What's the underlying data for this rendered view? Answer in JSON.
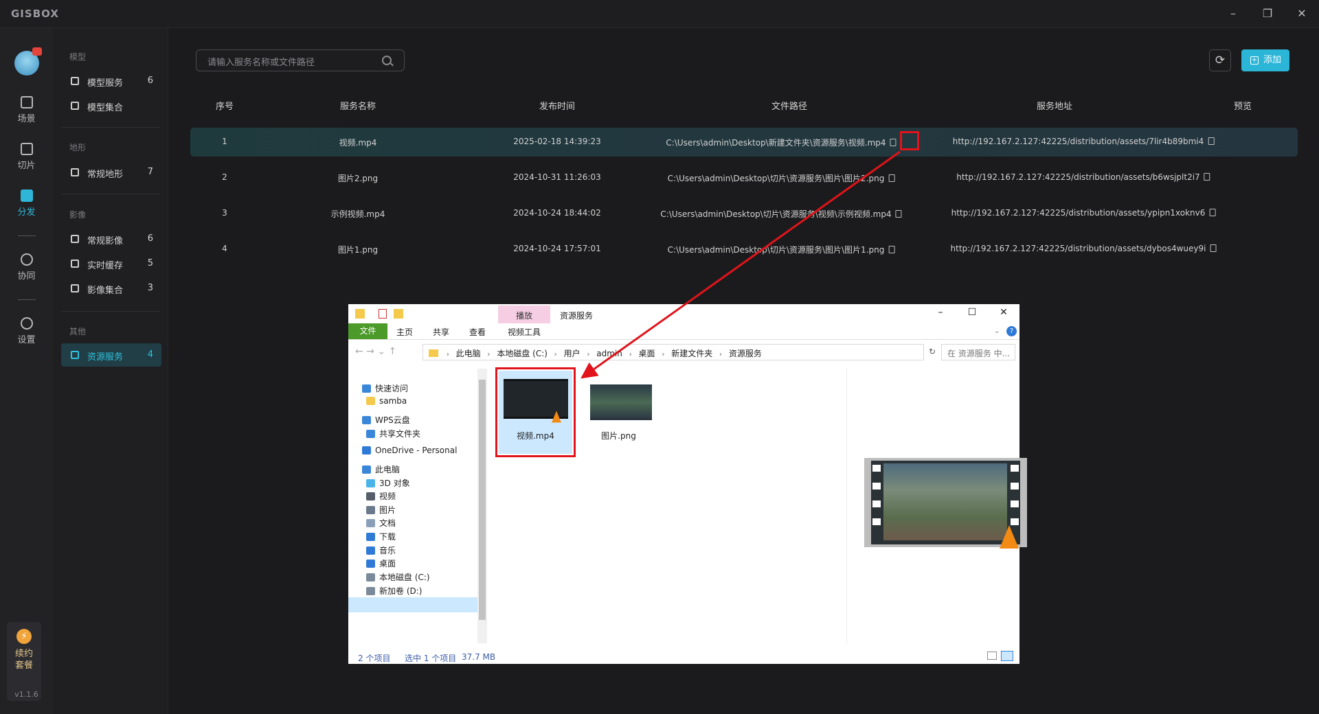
{
  "app": {
    "logo": "GISBOX",
    "version": "v1.1.6"
  },
  "rail": {
    "items": [
      {
        "label": "场景"
      },
      {
        "label": "切片"
      },
      {
        "label": "分发",
        "active": true
      },
      {
        "label": "协同"
      },
      {
        "label": "设置"
      }
    ],
    "promo": {
      "line1": "续约",
      "line2": "套餐"
    }
  },
  "nav": {
    "sections": [
      {
        "title": "模型",
        "items": [
          {
            "label": "模型服务",
            "count": "6"
          },
          {
            "label": "模型集合",
            "count": ""
          }
        ]
      },
      {
        "title": "地形",
        "items": [
          {
            "label": "常规地形",
            "count": "7"
          }
        ]
      },
      {
        "title": "影像",
        "items": [
          {
            "label": "常规影像",
            "count": "6"
          },
          {
            "label": "实时缓存",
            "count": "5"
          },
          {
            "label": "影像集合",
            "count": "3"
          }
        ]
      },
      {
        "title": "其他",
        "items": [
          {
            "label": "资源服务",
            "count": "4",
            "active": true
          }
        ]
      }
    ]
  },
  "toolbar": {
    "search_placeholder": "请输入服务名称或文件路径",
    "add_label": "添加"
  },
  "table": {
    "headers": [
      "序号",
      "服务名称",
      "发布时间",
      "文件路径",
      "服务地址",
      "预览"
    ],
    "rows": [
      {
        "idx": "1",
        "name": "视频.mp4",
        "time": "2025-02-18 14:39:23",
        "path": "C:\\Users\\admin\\Desktop\\新建文件夹\\资源服务\\视频.mp4",
        "url": "http://192.167.2.127:42225/distribution/assets/7lir4b89bmi4",
        "selected": true
      },
      {
        "idx": "2",
        "name": "图片2.png",
        "time": "2024-10-31 11:26:03",
        "path": "C:\\Users\\admin\\Desktop\\切片\\资源服务\\图片\\图片2.png",
        "url": "http://192.167.2.127:42225/distribution/assets/b6wsjplt2i7"
      },
      {
        "idx": "3",
        "name": "示例视频.mp4",
        "time": "2024-10-24 18:44:02",
        "path": "C:\\Users\\admin\\Desktop\\切片\\资源服务\\视频\\示例视频.mp4",
        "url": "http://192.167.2.127:42225/distribution/assets/ypipn1xoknv6"
      },
      {
        "idx": "4",
        "name": "图片1.png",
        "time": "2024-10-24 17:57:01",
        "path": "C:\\Users\\admin\\Desktop\\切片\\资源服务\\图片\\图片1.png",
        "url": "http://192.167.2.127:42225/distribution/assets/dybos4wuey9i"
      }
    ]
  },
  "explorer": {
    "context_tab": "播放",
    "title": "资源服务",
    "ribbon": {
      "file": "文件",
      "home": "主页",
      "share": "共享",
      "view": "查看",
      "tools": "视频工具"
    },
    "address": [
      "此电脑",
      "本地磁盘 (C:)",
      "用户",
      "admin",
      "桌面",
      "新建文件夹",
      "资源服务"
    ],
    "search_placeholder": "在 资源服务 中...",
    "tree": [
      {
        "label": "快速访问",
        "color": "#3a86d9"
      },
      {
        "label": "samba",
        "color": "#f4c94c"
      },
      {
        "label": "WPS云盘",
        "color": "#3a86d9"
      },
      {
        "label": "共享文件夹",
        "color": "#3a86d9"
      },
      {
        "label": "OneDrive - Personal",
        "color": "#2f7ad6"
      },
      {
        "label": "此电脑",
        "color": "#3a86d9"
      },
      {
        "label": "3D 对象",
        "color": "#4ab3e8"
      },
      {
        "label": "视频",
        "color": "#555e6a"
      },
      {
        "label": "图片",
        "color": "#6a7a8c"
      },
      {
        "label": "文档",
        "color": "#8aa0b8"
      },
      {
        "label": "下载",
        "color": "#2f7ad6"
      },
      {
        "label": "音乐",
        "color": "#2f7ad6"
      },
      {
        "label": "桌面",
        "color": "#2f7ad6"
      },
      {
        "label": "本地磁盘 (C:)",
        "color": "#7a8a9a"
      },
      {
        "label": "新加卷 (D:)",
        "color": "#7a8a9a"
      }
    ],
    "files": [
      {
        "name": "视频.mp4"
      },
      {
        "name": "图片.png"
      }
    ],
    "status": {
      "count": "2 个项目",
      "selected": "选中 1 个项目",
      "size": "37.7 MB"
    }
  }
}
